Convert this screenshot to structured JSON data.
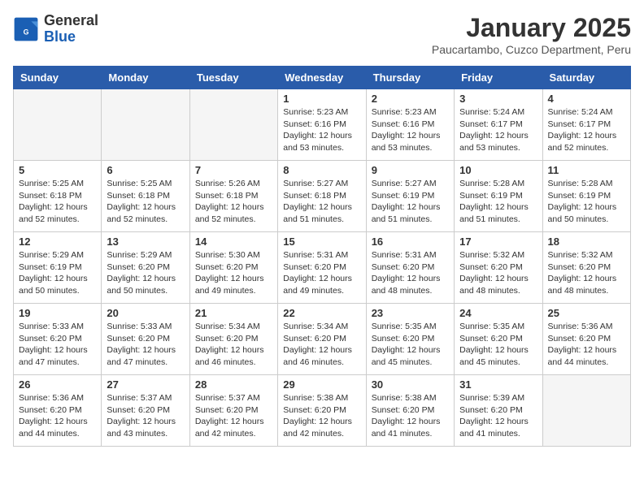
{
  "logo": {
    "general": "General",
    "blue": "Blue"
  },
  "title": "January 2025",
  "subtitle": "Paucartambo, Cuzco Department, Peru",
  "days_of_week": [
    "Sunday",
    "Monday",
    "Tuesday",
    "Wednesday",
    "Thursday",
    "Friday",
    "Saturday"
  ],
  "weeks": [
    [
      {
        "day": null,
        "info": null
      },
      {
        "day": null,
        "info": null
      },
      {
        "day": null,
        "info": null
      },
      {
        "day": "1",
        "info": "Sunrise: 5:23 AM\nSunset: 6:16 PM\nDaylight: 12 hours\nand 53 minutes."
      },
      {
        "day": "2",
        "info": "Sunrise: 5:23 AM\nSunset: 6:16 PM\nDaylight: 12 hours\nand 53 minutes."
      },
      {
        "day": "3",
        "info": "Sunrise: 5:24 AM\nSunset: 6:17 PM\nDaylight: 12 hours\nand 53 minutes."
      },
      {
        "day": "4",
        "info": "Sunrise: 5:24 AM\nSunset: 6:17 PM\nDaylight: 12 hours\nand 52 minutes."
      }
    ],
    [
      {
        "day": "5",
        "info": "Sunrise: 5:25 AM\nSunset: 6:18 PM\nDaylight: 12 hours\nand 52 minutes."
      },
      {
        "day": "6",
        "info": "Sunrise: 5:25 AM\nSunset: 6:18 PM\nDaylight: 12 hours\nand 52 minutes."
      },
      {
        "day": "7",
        "info": "Sunrise: 5:26 AM\nSunset: 6:18 PM\nDaylight: 12 hours\nand 52 minutes."
      },
      {
        "day": "8",
        "info": "Sunrise: 5:27 AM\nSunset: 6:18 PM\nDaylight: 12 hours\nand 51 minutes."
      },
      {
        "day": "9",
        "info": "Sunrise: 5:27 AM\nSunset: 6:19 PM\nDaylight: 12 hours\nand 51 minutes."
      },
      {
        "day": "10",
        "info": "Sunrise: 5:28 AM\nSunset: 6:19 PM\nDaylight: 12 hours\nand 51 minutes."
      },
      {
        "day": "11",
        "info": "Sunrise: 5:28 AM\nSunset: 6:19 PM\nDaylight: 12 hours\nand 50 minutes."
      }
    ],
    [
      {
        "day": "12",
        "info": "Sunrise: 5:29 AM\nSunset: 6:19 PM\nDaylight: 12 hours\nand 50 minutes."
      },
      {
        "day": "13",
        "info": "Sunrise: 5:29 AM\nSunset: 6:20 PM\nDaylight: 12 hours\nand 50 minutes."
      },
      {
        "day": "14",
        "info": "Sunrise: 5:30 AM\nSunset: 6:20 PM\nDaylight: 12 hours\nand 49 minutes."
      },
      {
        "day": "15",
        "info": "Sunrise: 5:31 AM\nSunset: 6:20 PM\nDaylight: 12 hours\nand 49 minutes."
      },
      {
        "day": "16",
        "info": "Sunrise: 5:31 AM\nSunset: 6:20 PM\nDaylight: 12 hours\nand 48 minutes."
      },
      {
        "day": "17",
        "info": "Sunrise: 5:32 AM\nSunset: 6:20 PM\nDaylight: 12 hours\nand 48 minutes."
      },
      {
        "day": "18",
        "info": "Sunrise: 5:32 AM\nSunset: 6:20 PM\nDaylight: 12 hours\nand 48 minutes."
      }
    ],
    [
      {
        "day": "19",
        "info": "Sunrise: 5:33 AM\nSunset: 6:20 PM\nDaylight: 12 hours\nand 47 minutes."
      },
      {
        "day": "20",
        "info": "Sunrise: 5:33 AM\nSunset: 6:20 PM\nDaylight: 12 hours\nand 47 minutes."
      },
      {
        "day": "21",
        "info": "Sunrise: 5:34 AM\nSunset: 6:20 PM\nDaylight: 12 hours\nand 46 minutes."
      },
      {
        "day": "22",
        "info": "Sunrise: 5:34 AM\nSunset: 6:20 PM\nDaylight: 12 hours\nand 46 minutes."
      },
      {
        "day": "23",
        "info": "Sunrise: 5:35 AM\nSunset: 6:20 PM\nDaylight: 12 hours\nand 45 minutes."
      },
      {
        "day": "24",
        "info": "Sunrise: 5:35 AM\nSunset: 6:20 PM\nDaylight: 12 hours\nand 45 minutes."
      },
      {
        "day": "25",
        "info": "Sunrise: 5:36 AM\nSunset: 6:20 PM\nDaylight: 12 hours\nand 44 minutes."
      }
    ],
    [
      {
        "day": "26",
        "info": "Sunrise: 5:36 AM\nSunset: 6:20 PM\nDaylight: 12 hours\nand 44 minutes."
      },
      {
        "day": "27",
        "info": "Sunrise: 5:37 AM\nSunset: 6:20 PM\nDaylight: 12 hours\nand 43 minutes."
      },
      {
        "day": "28",
        "info": "Sunrise: 5:37 AM\nSunset: 6:20 PM\nDaylight: 12 hours\nand 42 minutes."
      },
      {
        "day": "29",
        "info": "Sunrise: 5:38 AM\nSunset: 6:20 PM\nDaylight: 12 hours\nand 42 minutes."
      },
      {
        "day": "30",
        "info": "Sunrise: 5:38 AM\nSunset: 6:20 PM\nDaylight: 12 hours\nand 41 minutes."
      },
      {
        "day": "31",
        "info": "Sunrise: 5:39 AM\nSunset: 6:20 PM\nDaylight: 12 hours\nand 41 minutes."
      },
      {
        "day": null,
        "info": null
      }
    ]
  ]
}
